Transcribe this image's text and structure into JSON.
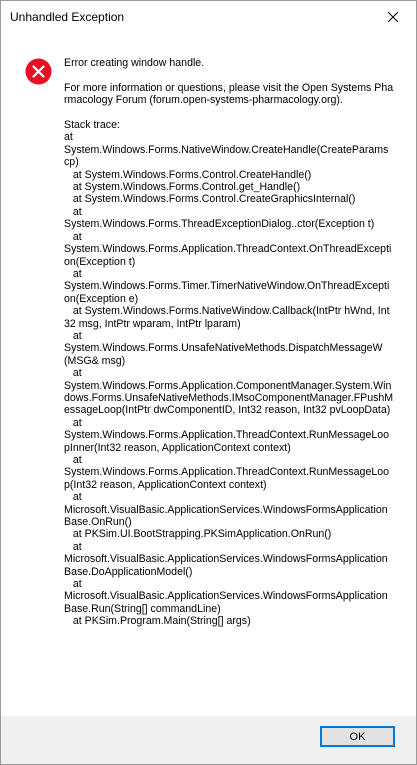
{
  "window": {
    "title": "Unhandled Exception"
  },
  "icons": {
    "close": "close-icon",
    "error": "error-icon"
  },
  "colors": {
    "error_red": "#e81123",
    "button_border": "#0078d7",
    "footer_bg": "#f0f0f0"
  },
  "message": {
    "text": "Error creating window handle.\n\nFor more information or questions, please visit the Open Systems Pharmacology Forum (forum.open-systems-pharmacology.org).\n\nStack trace:\nat\nSystem.Windows.Forms.NativeWindow.CreateHandle(CreateParams cp)\n   at System.Windows.Forms.Control.CreateHandle()\n   at System.Windows.Forms.Control.get_Handle()\n   at System.Windows.Forms.Control.CreateGraphicsInternal()\n   at\nSystem.Windows.Forms.ThreadExceptionDialog..ctor(Exception t)\n   at\nSystem.Windows.Forms.Application.ThreadContext.OnThreadException(Exception t)\n   at\nSystem.Windows.Forms.Timer.TimerNativeWindow.OnThreadException(Exception e)\n   at System.Windows.Forms.NativeWindow.Callback(IntPtr hWnd, Int32 msg, IntPtr wparam, IntPtr lparam)\n   at\nSystem.Windows.Forms.UnsafeNativeMethods.DispatchMessageW(MSG& msg)\n   at\nSystem.Windows.Forms.Application.ComponentManager.System.Windows.Forms.UnsafeNativeMethods.IMsoComponentManager.FPushMessageLoop(IntPtr dwComponentID, Int32 reason, Int32 pvLoopData)\n   at\nSystem.Windows.Forms.Application.ThreadContext.RunMessageLoopInner(Int32 reason, ApplicationContext context)\n   at\nSystem.Windows.Forms.Application.ThreadContext.RunMessageLoop(Int32 reason, ApplicationContext context)\n   at\nMicrosoft.VisualBasic.ApplicationServices.WindowsFormsApplicationBase.OnRun()\n   at PKSim.UI.BootStrapping.PKSimApplication.OnRun()\n   at\nMicrosoft.VisualBasic.ApplicationServices.WindowsFormsApplicationBase.DoApplicationModel()\n   at\nMicrosoft.VisualBasic.ApplicationServices.WindowsFormsApplicationBase.Run(String[] commandLine)\n   at PKSim.Program.Main(String[] args)"
  },
  "buttons": {
    "ok_label": "OK"
  }
}
